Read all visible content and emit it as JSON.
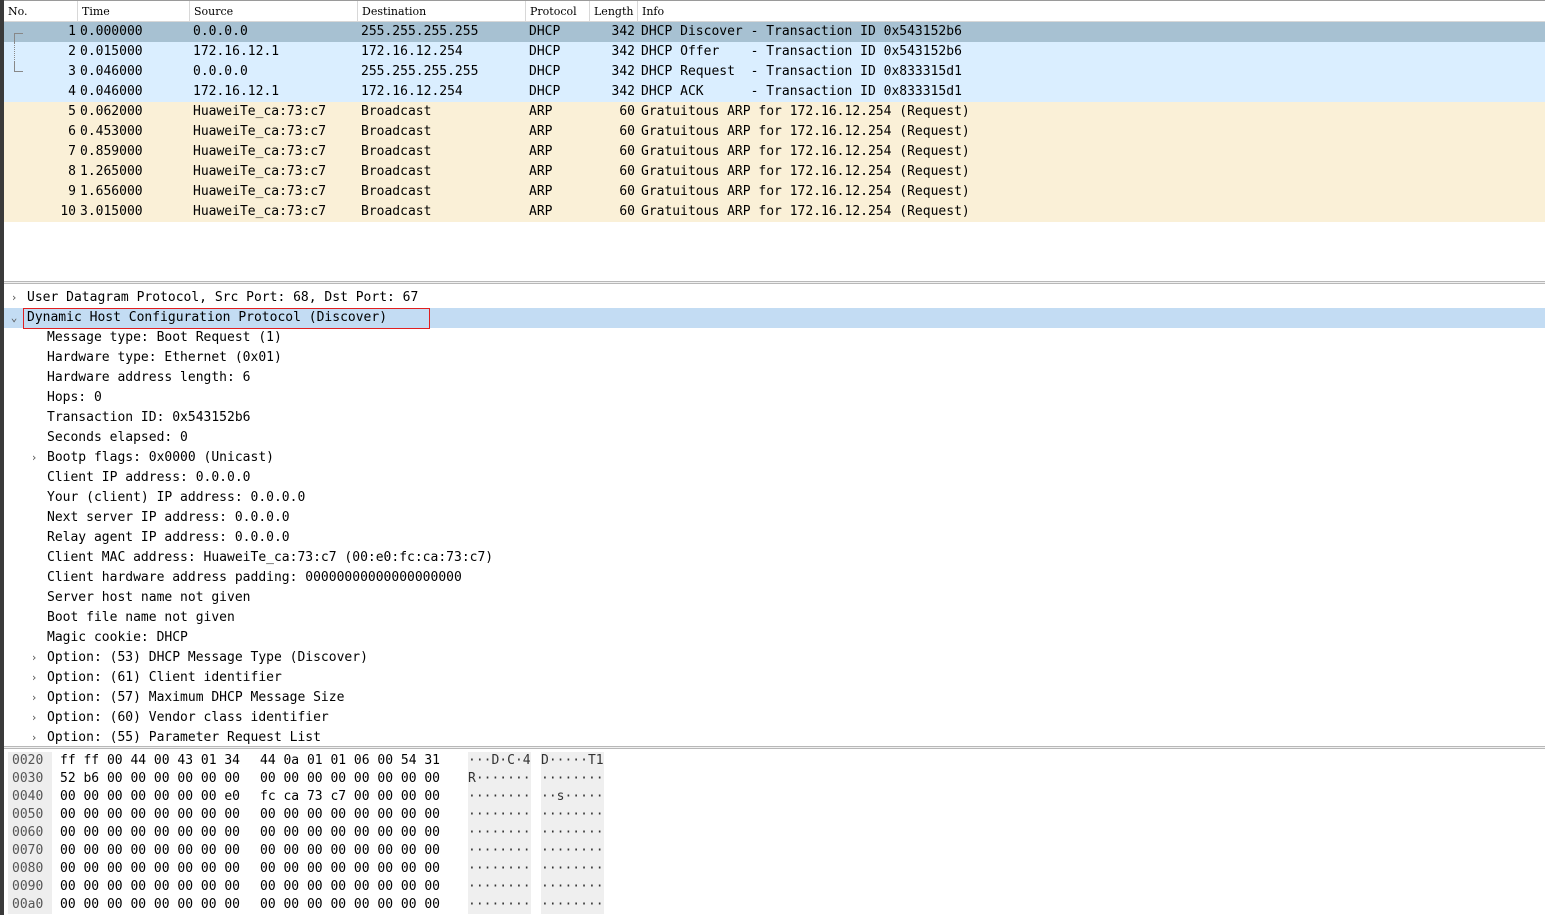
{
  "packet_list": {
    "columns": [
      "No.",
      "Time",
      "Source",
      "Destination",
      "Protocol",
      "Length",
      "Info"
    ],
    "rows": [
      {
        "no": "1",
        "time": "0.000000",
        "source": "0.0.0.0",
        "destination": "255.255.255.255",
        "protocol": "DHCP",
        "length": "342",
        "info": "DHCP Discover - Transaction ID 0x543152b6"
      },
      {
        "no": "2",
        "time": "0.015000",
        "source": "172.16.12.1",
        "destination": "172.16.12.254",
        "protocol": "DHCP",
        "length": "342",
        "info": "DHCP Offer    - Transaction ID 0x543152b6"
      },
      {
        "no": "3",
        "time": "0.046000",
        "source": "0.0.0.0",
        "destination": "255.255.255.255",
        "protocol": "DHCP",
        "length": "342",
        "info": "DHCP Request  - Transaction ID 0x833315d1"
      },
      {
        "no": "4",
        "time": "0.046000",
        "source": "172.16.12.1",
        "destination": "172.16.12.254",
        "protocol": "DHCP",
        "length": "342",
        "info": "DHCP ACK      - Transaction ID 0x833315d1"
      },
      {
        "no": "5",
        "time": "0.062000",
        "source": "HuaweiTe_ca:73:c7",
        "destination": "Broadcast",
        "protocol": "ARP",
        "length": "60",
        "info": "Gratuitous ARP for 172.16.12.254 (Request)"
      },
      {
        "no": "6",
        "time": "0.453000",
        "source": "HuaweiTe_ca:73:c7",
        "destination": "Broadcast",
        "protocol": "ARP",
        "length": "60",
        "info": "Gratuitous ARP for 172.16.12.254 (Request)"
      },
      {
        "no": "7",
        "time": "0.859000",
        "source": "HuaweiTe_ca:73:c7",
        "destination": "Broadcast",
        "protocol": "ARP",
        "length": "60",
        "info": "Gratuitous ARP for 172.16.12.254 (Request)"
      },
      {
        "no": "8",
        "time": "1.265000",
        "source": "HuaweiTe_ca:73:c7",
        "destination": "Broadcast",
        "protocol": "ARP",
        "length": "60",
        "info": "Gratuitous ARP for 172.16.12.254 (Request)"
      },
      {
        "no": "9",
        "time": "1.656000",
        "source": "HuaweiTe_ca:73:c7",
        "destination": "Broadcast",
        "protocol": "ARP",
        "length": "60",
        "info": "Gratuitous ARP for 172.16.12.254 (Request)"
      },
      {
        "no": "10",
        "time": "3.015000",
        "source": "HuaweiTe_ca:73:c7",
        "destination": "Broadcast",
        "protocol": "ARP",
        "length": "60",
        "info": "Gratuitous ARP for 172.16.12.254 (Request)"
      }
    ]
  },
  "details": {
    "udp_header": "User Datagram Protocol, Src Port: 68, Dst Port: 67",
    "dhcp_header": "Dynamic Host Configuration Protocol (Discover)",
    "fields": [
      {
        "text": "Message type: Boot Request (1)",
        "expandable": false
      },
      {
        "text": "Hardware type: Ethernet (0x01)",
        "expandable": false
      },
      {
        "text": "Hardware address length: 6",
        "expandable": false
      },
      {
        "text": "Hops: 0",
        "expandable": false
      },
      {
        "text": "Transaction ID: 0x543152b6",
        "expandable": false
      },
      {
        "text": "Seconds elapsed: 0",
        "expandable": false
      },
      {
        "text": "Bootp flags: 0x0000 (Unicast)",
        "expandable": true
      },
      {
        "text": "Client IP address: 0.0.0.0",
        "expandable": false
      },
      {
        "text": "Your (client) IP address: 0.0.0.0",
        "expandable": false
      },
      {
        "text": "Next server IP address: 0.0.0.0",
        "expandable": false
      },
      {
        "text": "Relay agent IP address: 0.0.0.0",
        "expandable": false
      },
      {
        "text": "Client MAC address: HuaweiTe_ca:73:c7 (00:e0:fc:ca:73:c7)",
        "expandable": false
      },
      {
        "text": "Client hardware address padding: 00000000000000000000",
        "expandable": false
      },
      {
        "text": "Server host name not given",
        "expandable": false
      },
      {
        "text": "Boot file name not given",
        "expandable": false
      },
      {
        "text": "Magic cookie: DHCP",
        "expandable": false
      },
      {
        "text": "Option: (53) DHCP Message Type (Discover)",
        "expandable": true
      },
      {
        "text": "Option: (61) Client identifier",
        "expandable": true
      },
      {
        "text": "Option: (57) Maximum DHCP Message Size",
        "expandable": true
      },
      {
        "text": "Option: (60) Vendor class identifier",
        "expandable": true
      },
      {
        "text": "Option: (55) Parameter Request List",
        "expandable": true
      }
    ]
  },
  "bytes": [
    {
      "offset": "0020",
      "hex1": "ff ff 00 44 00 43 01 34",
      "hex2": "44 0a 01 01 06 00 54 31",
      "ascii1": "···D·C·4",
      "ascii2": "D·····T1"
    },
    {
      "offset": "0030",
      "hex1": "52 b6 00 00 00 00 00 00",
      "hex2": "00 00 00 00 00 00 00 00",
      "ascii1": "R·······",
      "ascii2": "········"
    },
    {
      "offset": "0040",
      "hex1": "00 00 00 00 00 00 00 e0",
      "hex2": "fc ca 73 c7 00 00 00 00",
      "ascii1": "········",
      "ascii2": "··s·····"
    },
    {
      "offset": "0050",
      "hex1": "00 00 00 00 00 00 00 00",
      "hex2": "00 00 00 00 00 00 00 00",
      "ascii1": "········",
      "ascii2": "········"
    },
    {
      "offset": "0060",
      "hex1": "00 00 00 00 00 00 00 00",
      "hex2": "00 00 00 00 00 00 00 00",
      "ascii1": "········",
      "ascii2": "········"
    },
    {
      "offset": "0070",
      "hex1": "00 00 00 00 00 00 00 00",
      "hex2": "00 00 00 00 00 00 00 00",
      "ascii1": "········",
      "ascii2": "········"
    },
    {
      "offset": "0080",
      "hex1": "00 00 00 00 00 00 00 00",
      "hex2": "00 00 00 00 00 00 00 00",
      "ascii1": "········",
      "ascii2": "········"
    },
    {
      "offset": "0090",
      "hex1": "00 00 00 00 00 00 00 00",
      "hex2": "00 00 00 00 00 00 00 00",
      "ascii1": "········",
      "ascii2": "········"
    },
    {
      "offset": "00a0",
      "hex1": "00 00 00 00 00 00 00 00",
      "hex2": "00 00 00 00 00 00 00 00",
      "ascii1": "········",
      "ascii2": "········"
    }
  ],
  "colors": {
    "dhcp_row": "#daeeff",
    "arp_row": "#faf0d7",
    "selected_row": "#a7c1d2",
    "highlight": "#c3dcf3",
    "selection_box": "#e02020"
  },
  "icons": {
    "collapsed": "chevron-right-icon",
    "expanded": "chevron-down-icon"
  }
}
